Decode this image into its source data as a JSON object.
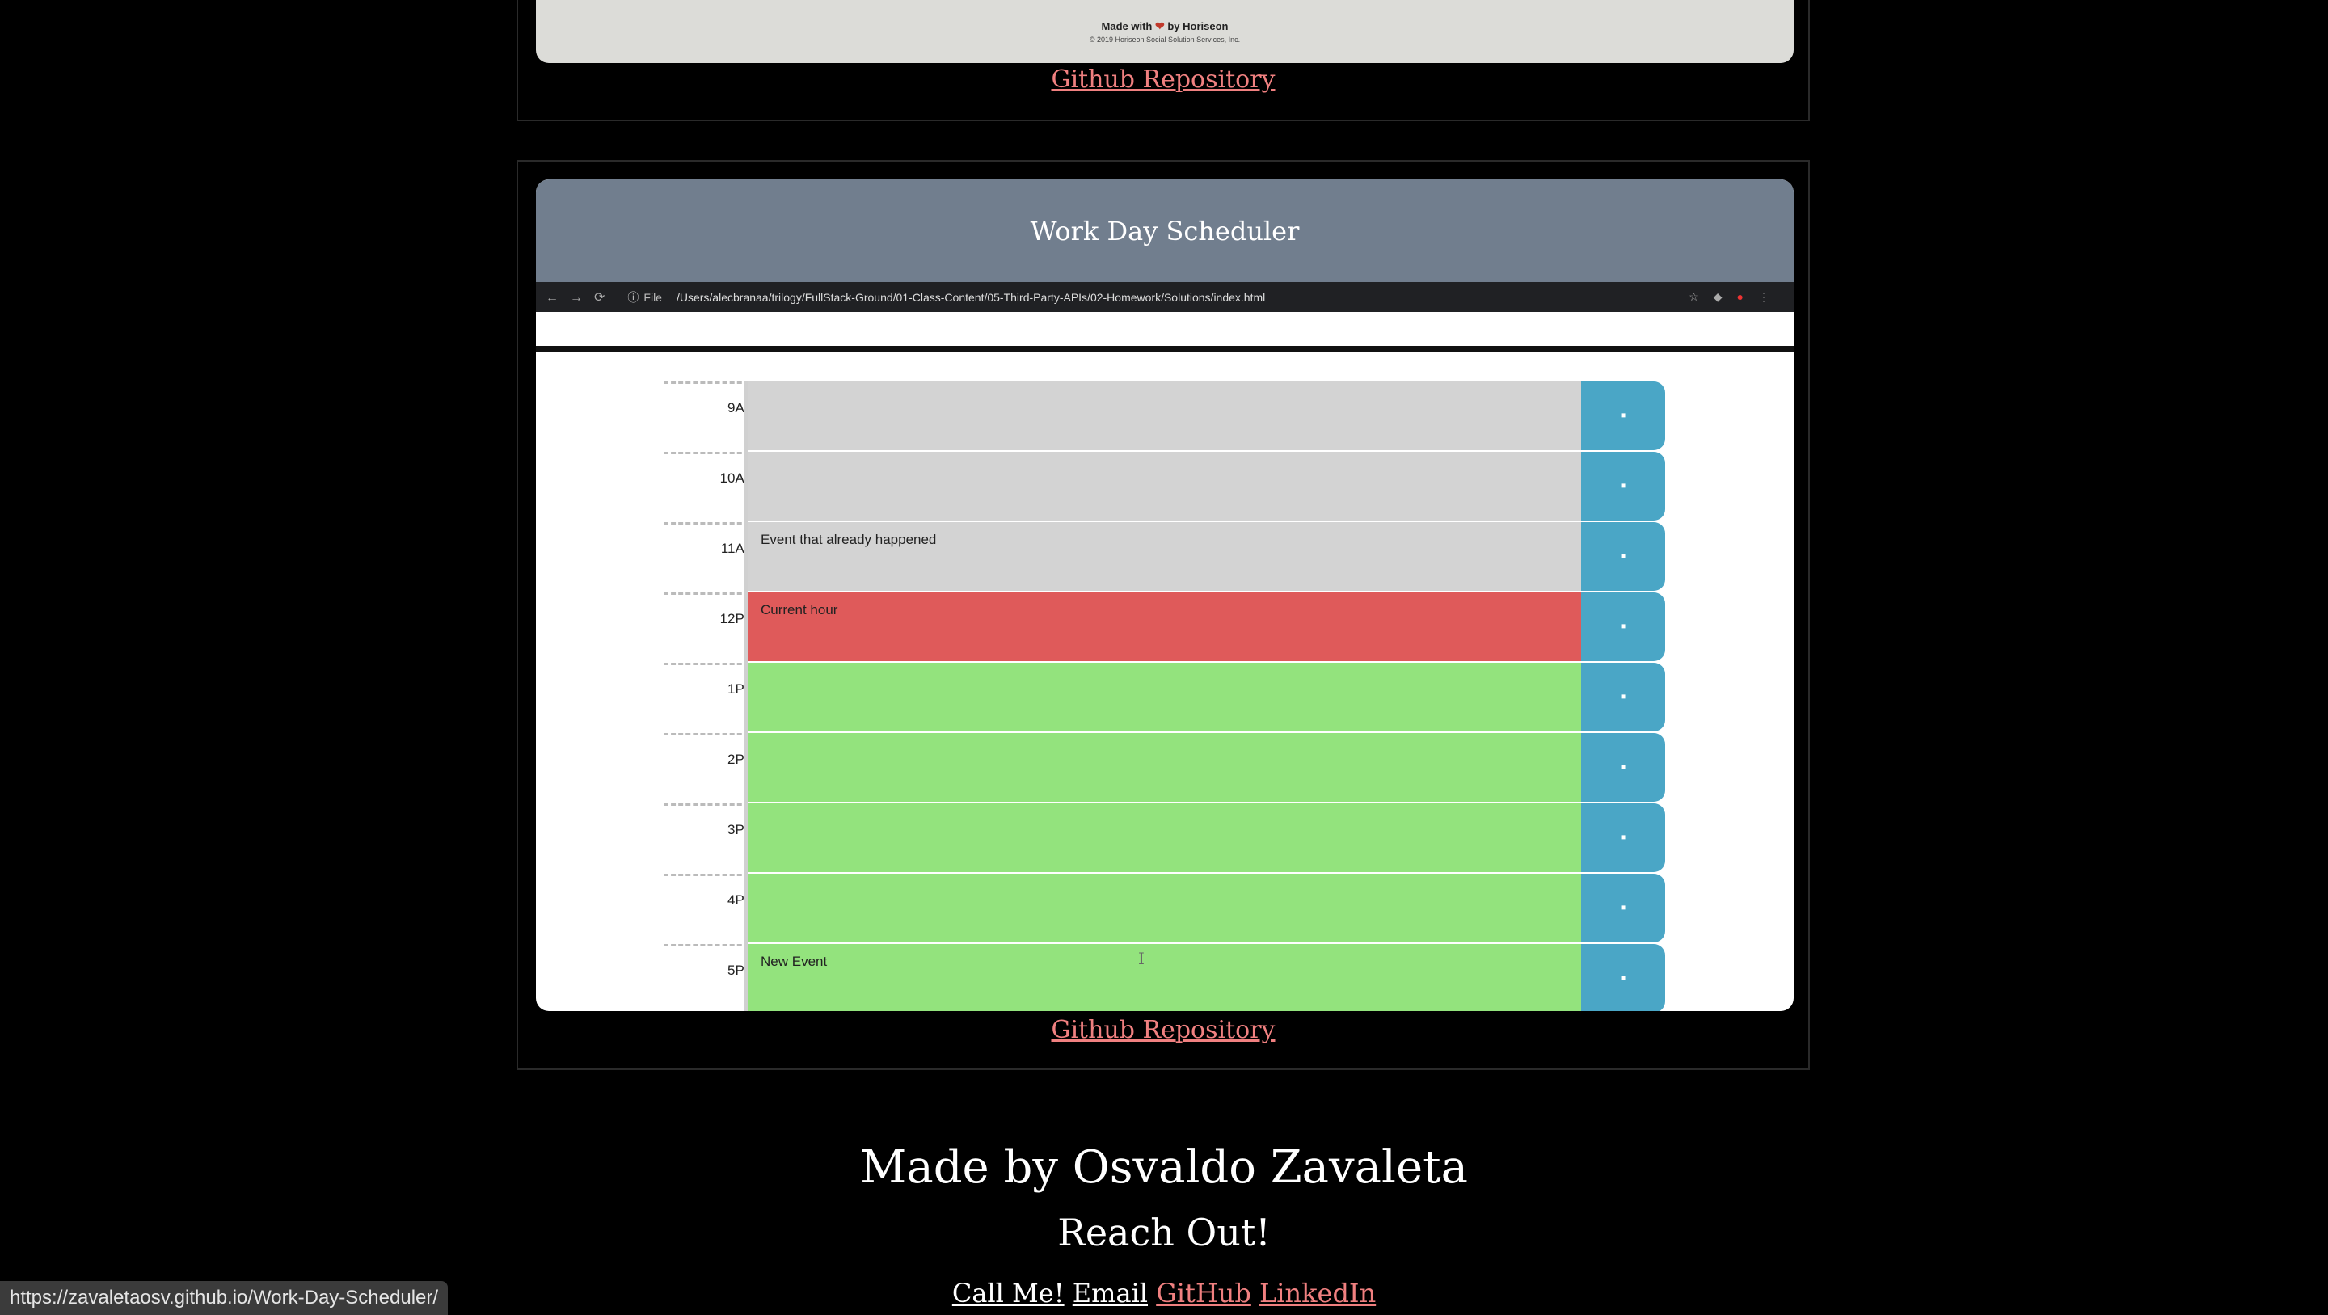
{
  "previous_project": {
    "made_with_prefix": "Made with",
    "made_with_suffix": "by Horiseon",
    "copyright": "© 2019 Horiseon Social Solution Services, Inc.",
    "repo_link": "Github Repository"
  },
  "project": {
    "title": "Work Day Scheduler",
    "browser": {
      "file_label": "File",
      "url": "/Users/alecbranaa/trilogy/FullStack-Ground/01-Class-Content/05-Third-Party-APIs/02-Homework/Solutions/index.html"
    },
    "schedule": [
      {
        "hour": "9AM",
        "status": "past",
        "event": ""
      },
      {
        "hour": "10AM",
        "status": "past",
        "event": ""
      },
      {
        "hour": "11AM",
        "status": "past",
        "event": "Event that already happened"
      },
      {
        "hour": "12PM",
        "status": "present",
        "event": "Current hour"
      },
      {
        "hour": "1PM",
        "status": "future",
        "event": ""
      },
      {
        "hour": "2PM",
        "status": "future",
        "event": ""
      },
      {
        "hour": "3PM",
        "status": "future",
        "event": ""
      },
      {
        "hour": "4PM",
        "status": "future",
        "event": ""
      },
      {
        "hour": "5PM",
        "status": "future",
        "event": "New Event"
      }
    ],
    "save_icon": "floppy-disk-icon",
    "repo_link": "Github Repository"
  },
  "footer": {
    "title": "Made by Osvaldo Zavaleta",
    "subtitle": "Reach Out!",
    "links": {
      "call": "Call Me!",
      "email": "Email",
      "github": "GitHub",
      "linkedin": "LinkedIn"
    }
  },
  "status_bar": {
    "url": "https://zavaletaosv.github.io/Work-Day-Scheduler/"
  },
  "colors": {
    "background": "#000000",
    "link": "#f08080",
    "header": "#717e8e",
    "past": "#d3d3d3",
    "present": "#df5a5a",
    "future": "#93e37d",
    "save": "#4aa6c6"
  }
}
